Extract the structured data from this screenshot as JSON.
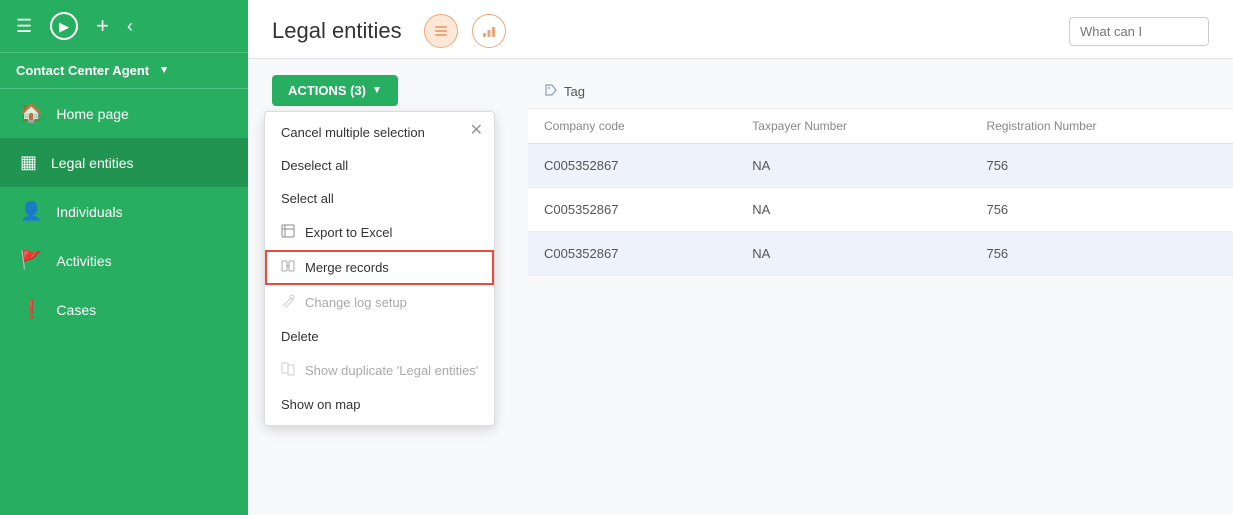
{
  "sidebar": {
    "top_icons": [
      "menu",
      "play",
      "plus",
      "back"
    ],
    "agent_label": "Contact Center Agent",
    "nav_items": [
      {
        "id": "home",
        "label": "Home page",
        "icon": "🏠"
      },
      {
        "id": "legal_entities",
        "label": "Legal entities",
        "icon": "🏢",
        "active": true
      },
      {
        "id": "individuals",
        "label": "Individuals",
        "icon": "👤"
      },
      {
        "id": "activities",
        "label": "Activities",
        "icon": "🚩"
      },
      {
        "id": "cases",
        "label": "Cases",
        "icon": "❗"
      }
    ]
  },
  "header": {
    "title": "Legal entities",
    "view_list_icon": "list",
    "view_chart_icon": "chart",
    "what_can_placeholder": "What can I"
  },
  "actions_button": {
    "label": "ACTIONS (3)",
    "caret": "▼"
  },
  "dropdown": {
    "items": [
      {
        "id": "cancel_selection",
        "label": "Cancel multiple selection",
        "icon": "",
        "disabled": false,
        "highlighted": false
      },
      {
        "id": "deselect_all",
        "label": "Deselect all",
        "icon": "",
        "disabled": false,
        "highlighted": false
      },
      {
        "id": "select_all",
        "label": "Select all",
        "icon": "",
        "disabled": false,
        "highlighted": false
      },
      {
        "id": "export_excel",
        "label": "Export to Excel",
        "icon": "⊞",
        "disabled": false,
        "highlighted": false
      },
      {
        "id": "merge_records",
        "label": "Merge records",
        "icon": "⇌",
        "disabled": false,
        "highlighted": true
      },
      {
        "id": "change_log",
        "label": "Change log setup",
        "icon": "✏",
        "disabled": true,
        "highlighted": false
      },
      {
        "id": "delete",
        "label": "Delete",
        "icon": "",
        "disabled": false,
        "highlighted": false
      },
      {
        "id": "show_duplicate",
        "label": "Show duplicate 'Legal entities'",
        "icon": "⇌",
        "disabled": true,
        "highlighted": false
      },
      {
        "id": "show_on_map",
        "label": "Show on map",
        "icon": "",
        "disabled": false,
        "highlighted": false
      }
    ]
  },
  "table": {
    "tag_label": "Tag",
    "columns": [
      "Company code",
      "Taxpayer Number",
      "Registration Number"
    ],
    "rows": [
      {
        "company_code": "C005352867",
        "taxpayer": "NA",
        "registration": "756"
      },
      {
        "company_code": "C005352867",
        "taxpayer": "NA",
        "registration": "756"
      },
      {
        "company_code": "C005352867",
        "taxpayer": "NA",
        "registration": "756"
      }
    ]
  }
}
